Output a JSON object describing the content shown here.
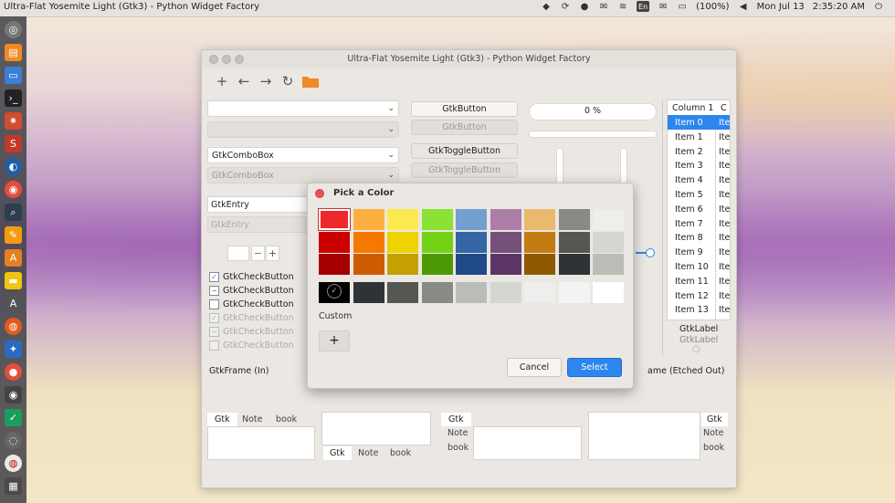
{
  "top_panel": {
    "title": "Ultra-Flat Yosemite Light (Gtk3) - Python Widget Factory",
    "keyboard_layout": "En",
    "battery": "(100%)",
    "date": "Mon Jul 13",
    "time": "2:35:20 AM"
  },
  "window": {
    "title": "Ultra-Flat Yosemite Light (Gtk3) - Python Widget Factory",
    "toolbar": [
      "add-icon",
      "back-icon",
      "forward-icon",
      "refresh-icon",
      "folder-icon"
    ]
  },
  "left_column": {
    "combo_empty_value": "",
    "combo_label": "GtkComboBox",
    "combo_label_disabled": "GtkComboBox",
    "entry_value": "GtkEntry",
    "entry_disabled_value": "GtkEntry",
    "spin_value": "",
    "spin_minus": "−",
    "spin_plus": "+",
    "checkbuttons": [
      {
        "label": "GtkCheckButton",
        "state": "checked",
        "mark": "✓"
      },
      {
        "label": "GtkCheckButton",
        "state": "mixed",
        "mark": "−"
      },
      {
        "label": "GtkCheckButton",
        "state": "unchecked",
        "mark": ""
      },
      {
        "label": "GtkCheckButton",
        "state": "checked-disabled",
        "mark": "✓"
      },
      {
        "label": "GtkCheckButton",
        "state": "mixed-disabled",
        "mark": "−"
      },
      {
        "label": "GtkCheckButton",
        "state": "unchecked-disabled",
        "mark": ""
      }
    ],
    "frame_in_label": "GtkFrame (In)"
  },
  "middle_column": {
    "button": "GtkButton",
    "button_disabled": "GtkButton",
    "toggle": "GtkToggleButton",
    "toggle_disabled": "GtkToggleButton"
  },
  "progress": {
    "label": "0 %",
    "value": 0
  },
  "treeview": {
    "col1": "Column 1",
    "col2": "C",
    "rows": [
      {
        "c1": "Item 0",
        "c2": "Ite",
        "selected": true
      },
      {
        "c1": "Item 1",
        "c2": "Ite",
        "selected": false
      },
      {
        "c1": "Item 2",
        "c2": "Ite",
        "selected": false
      },
      {
        "c1": "Item 3",
        "c2": "Ite",
        "selected": false
      },
      {
        "c1": "Item 4",
        "c2": "Ite",
        "selected": false
      },
      {
        "c1": "Item 5",
        "c2": "Ite",
        "selected": false
      },
      {
        "c1": "Item 6",
        "c2": "Ite",
        "selected": false
      },
      {
        "c1": "Item 7",
        "c2": "Ite",
        "selected": false
      },
      {
        "c1": "Item 8",
        "c2": "Ite",
        "selected": false
      },
      {
        "c1": "Item 9",
        "c2": "Ite",
        "selected": false
      },
      {
        "c1": "Item 10",
        "c2": "Ite",
        "selected": false
      },
      {
        "c1": "Item 11",
        "c2": "Ite",
        "selected": false
      },
      {
        "c1": "Item 12",
        "c2": "Ite",
        "selected": false
      },
      {
        "c1": "Item 13",
        "c2": "Ite",
        "selected": false
      }
    ],
    "label1": "GtkLabel",
    "label2": "GtkLabel",
    "frame_etched_label": "ame (Etched Out)"
  },
  "notebooks": {
    "nb1_tabs": [
      "Gtk",
      "Note",
      "book"
    ],
    "nb2_tabs": [
      "Gtk",
      "Note",
      "book"
    ],
    "nb3_tabs": [
      "Gtk",
      "Note",
      "book"
    ],
    "nb4_tabs": [
      "Gtk",
      "Note",
      "book"
    ]
  },
  "dialog": {
    "title": "Pick a Color",
    "swatch_rows": [
      [
        "#ef2929",
        "#fcaf3e",
        "#fce94f",
        "#8ae234",
        "#729fcf",
        "#ad7fa8",
        "#e9b96e",
        "#888a85",
        "#eeeeec"
      ],
      [
        "#cc0000",
        "#f57900",
        "#edd400",
        "#73d216",
        "#3465a4",
        "#75507b",
        "#c17d11",
        "#555753",
        "#d3d7cf"
      ],
      [
        "#a40000",
        "#ce5c00",
        "#c4a000",
        "#4e9a06",
        "#204a87",
        "#5c3566",
        "#8f5902",
        "#2e3436",
        "#babdb6"
      ]
    ],
    "gray_row": [
      "#000000",
      "#2e3436",
      "#555753",
      "#888a85",
      "#babdb6",
      "#d3d7cf",
      "#eeeeec",
      "#f3f3f3",
      "#ffffff"
    ],
    "custom_label": "Custom",
    "custom_add": "+",
    "cancel_label": "Cancel",
    "select_label": "Select"
  },
  "colors": {
    "accent": "#2d86ed",
    "launcher_bg": "#46464b",
    "window_bg": "#ebe7e3"
  }
}
